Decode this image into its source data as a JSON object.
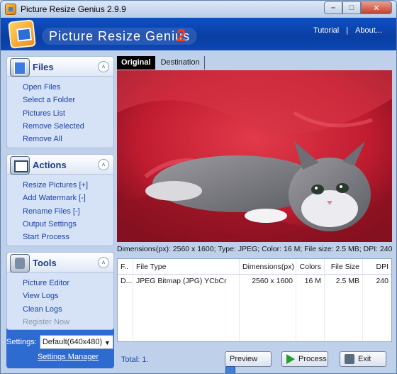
{
  "window": {
    "title": "Picture Resize Genius 2.9.9",
    "minimize_label": "–",
    "maximize_label": "□",
    "close_label": "✕"
  },
  "banner": {
    "logo_text": "Picture Resize Genius",
    "logo_version": "2",
    "links": {
      "tutorial": "Tutorial",
      "separator": "|",
      "about": "About..."
    }
  },
  "sidebar": {
    "files": {
      "title": "Files",
      "icon": "folder-files-icon",
      "items": [
        "Open Files",
        "Select a Folder",
        "Pictures List",
        "Remove Selected",
        "Remove All"
      ]
    },
    "actions": {
      "title": "Actions",
      "icon": "checklist-icon",
      "items": [
        "Resize Pictures [+]",
        "Add Watermark [-]",
        "Rename Files [-]",
        "Output Settings",
        "Start Process"
      ]
    },
    "tools": {
      "title": "Tools",
      "icon": "tools-icon",
      "items": [
        "Picture Editor",
        "View Logs",
        "Clean Logs",
        "Register Now"
      ]
    },
    "collapse_glyph": "˄",
    "settings_label": "Settings:",
    "settings_value": "Default(640x480)",
    "settings_arrow": "▼",
    "settings_manager": "Settings Manager"
  },
  "main": {
    "tabs": [
      {
        "label": "Original",
        "active": true
      },
      {
        "label": "Destination",
        "active": false
      }
    ],
    "info_line": "Dimensions(px): 2560 x 1600; Type: JPEG; Color: 16 M; File size: 2.5 MB; DPI: 240",
    "table": {
      "columns": [
        "F..",
        "File Type",
        "Dimensions(px)",
        "Colors",
        "File Size",
        "DPI"
      ],
      "rows": [
        [
          "D...",
          "JPEG Bitmap (JPG) YCbCr",
          "2560 x 1600",
          "16 M",
          "2.5 MB",
          "240"
        ]
      ]
    },
    "total": "Total: 1.",
    "buttons": {
      "preview": "Preview",
      "process": "Process",
      "exit": "Exit"
    }
  },
  "colors": {
    "banner": "#0e4fc4",
    "link": "#1c44a8",
    "accent_red": "#ff3b1a"
  }
}
